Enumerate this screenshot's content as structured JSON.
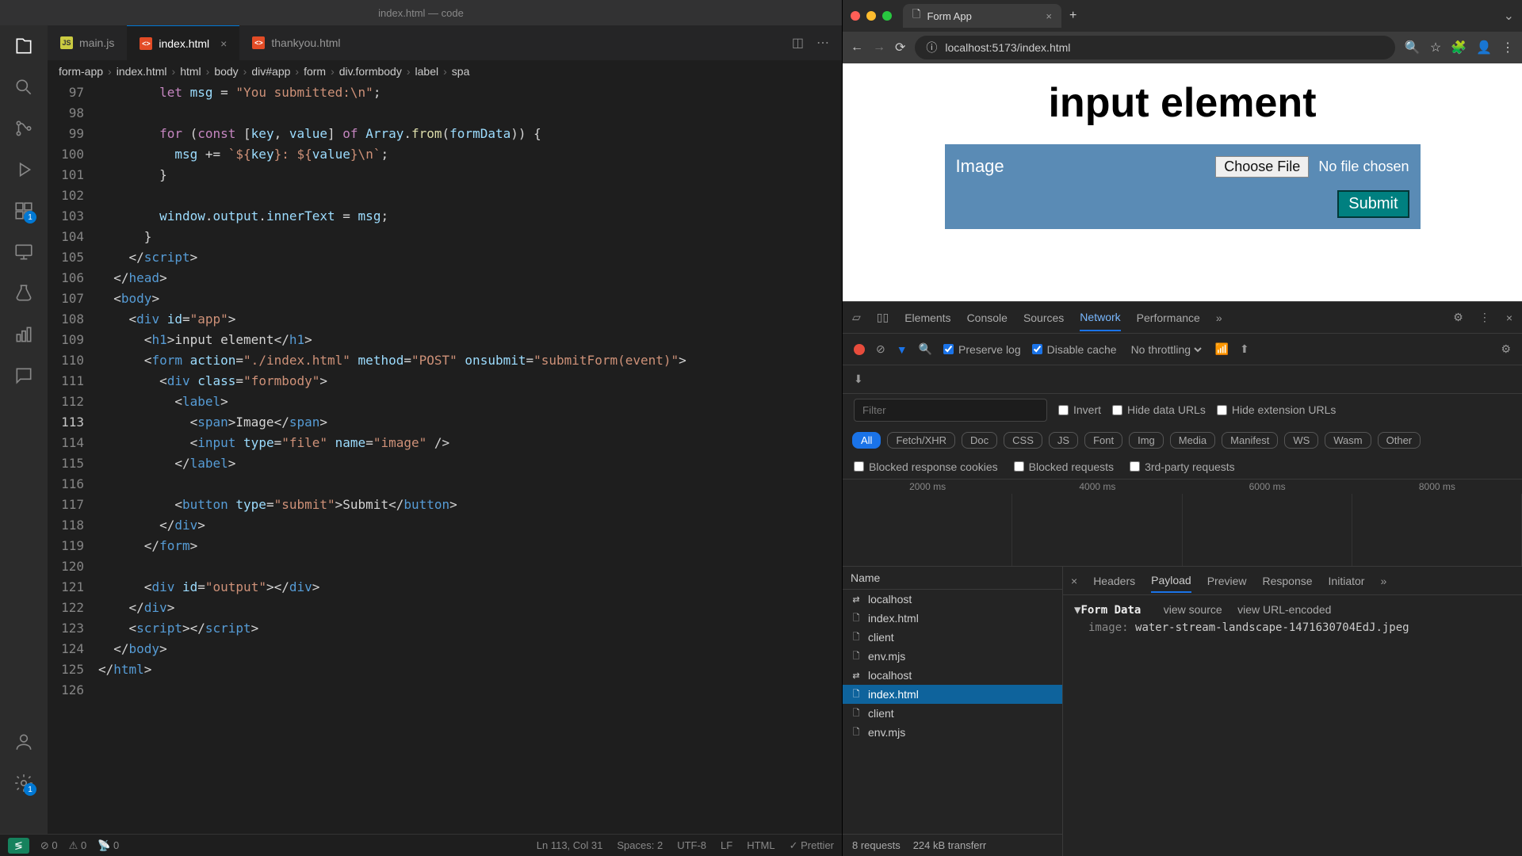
{
  "vscode": {
    "window_title": "index.html — code",
    "tabs": [
      "main.js",
      "index.html",
      "thankyou.html"
    ],
    "active_tab": 1,
    "breadcrumb": [
      "form-app",
      "index.html",
      "html",
      "body",
      "div#app",
      "form",
      "div.formbody",
      "label",
      "spa"
    ],
    "activity_badges": {
      "extensions": "1",
      "settings": "1"
    },
    "line_numbers": [
      "97",
      "98",
      "99",
      "100",
      "101",
      "102",
      "103",
      "104",
      "105",
      "106",
      "107",
      "108",
      "109",
      "110",
      "111",
      "112",
      "113",
      "114",
      "115",
      "116",
      "117",
      "118",
      "119",
      "120",
      "121",
      "122",
      "123",
      "124",
      "125",
      "126"
    ],
    "active_line_idx": 16,
    "status": {
      "remote_icon": "≶",
      "errors": "0",
      "warnings": "0",
      "radio": "0",
      "cursor": "Ln 113, Col 31",
      "spaces": "Spaces: 2",
      "encoding": "UTF-8",
      "eol": "LF",
      "lang": "HTML",
      "prettier": "✓ Prettier"
    }
  },
  "browser": {
    "tab_title": "Form App",
    "url": "localhost:5173/index.html",
    "page_heading": "input element",
    "label_text": "Image",
    "file_button": "Choose File",
    "file_status": "No file chosen",
    "submit": "Submit"
  },
  "devtools": {
    "main_tabs": [
      "Elements",
      "Console",
      "Sources",
      "Network",
      "Performance"
    ],
    "active_main_tab": 3,
    "preserve_log": "Preserve log",
    "disable_cache": "Disable cache",
    "throttling": "No throttling",
    "filter_placeholder": "Filter",
    "invert": "Invert",
    "hide_data_urls": "Hide data URLs",
    "hide_ext_urls": "Hide extension URLs",
    "chips": [
      "All",
      "Fetch/XHR",
      "Doc",
      "CSS",
      "JS",
      "Font",
      "Img",
      "Media",
      "Manifest",
      "WS",
      "Wasm",
      "Other"
    ],
    "active_chip": 0,
    "blocked_cookies": "Blocked response cookies",
    "blocked_requests": "Blocked requests",
    "third_party": "3rd-party requests",
    "timeline_labels": [
      "2000 ms",
      "4000 ms",
      "6000 ms",
      "8000 ms"
    ],
    "name_header": "Name",
    "requests": [
      "localhost",
      "index.html",
      "client",
      "env.mjs",
      "localhost",
      "index.html",
      "client",
      "env.mjs"
    ],
    "selected_request": 5,
    "detail_tabs": [
      "Headers",
      "Payload",
      "Preview",
      "Response",
      "Initiator"
    ],
    "active_detail_tab": 1,
    "form_data_label": "Form Data",
    "view_source": "view source",
    "view_url": "view URL-encoded",
    "form_key": "image:",
    "form_value": "water-stream-landscape-1471630704EdJ.jpeg",
    "status_requests": "8 requests",
    "status_transfer": "224 kB transferr"
  }
}
